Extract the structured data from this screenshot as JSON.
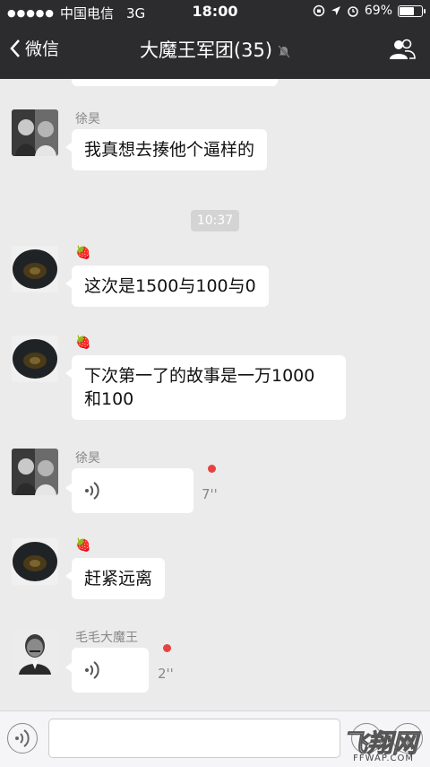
{
  "status": {
    "carrier": "中国电信",
    "network": "3G",
    "time": "18:00",
    "battery": "69%",
    "battery_level": 0.69
  },
  "nav": {
    "back_label": "微信",
    "title": "大魔王军团(35)"
  },
  "timestamp": "10:37",
  "messages": [
    {
      "sender": "徐昊",
      "text": "我真想去揍他个逼样的"
    },
    {
      "sender": "🍓",
      "text": "这次是1500与100与0"
    },
    {
      "sender": "🍓",
      "text_line1": "下次第一了的故事是一万1000",
      "text_line2": "和100"
    },
    {
      "sender": "徐昊",
      "duration": "7''"
    },
    {
      "sender": "🍓",
      "text": "赶紧远离"
    },
    {
      "sender": "毛毛大魔王",
      "duration": "2''"
    }
  ],
  "watermark": {
    "big": "飞翔网",
    "small": "FFWAP.COM"
  }
}
